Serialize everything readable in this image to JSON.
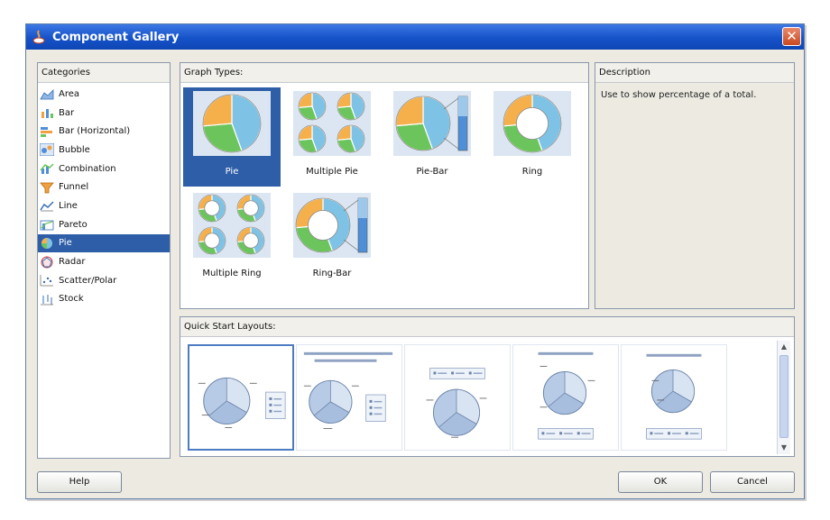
{
  "window": {
    "title": "Component Gallery",
    "close_glyph": "✕"
  },
  "categories": {
    "header": "Categories",
    "items": [
      {
        "label": "Area",
        "icon": "area-chart-icon"
      },
      {
        "label": "Bar",
        "icon": "bar-chart-icon"
      },
      {
        "label": "Bar (Horizontal)",
        "icon": "horizontal-bar-chart-icon"
      },
      {
        "label": "Bubble",
        "icon": "bubble-chart-icon"
      },
      {
        "label": "Combination",
        "icon": "combination-chart-icon"
      },
      {
        "label": "Funnel",
        "icon": "funnel-chart-icon"
      },
      {
        "label": "Line",
        "icon": "line-chart-icon"
      },
      {
        "label": "Pareto",
        "icon": "pareto-chart-icon"
      },
      {
        "label": "Pie",
        "icon": "pie-chart-icon",
        "selected": true
      },
      {
        "label": "Radar",
        "icon": "radar-chart-icon"
      },
      {
        "label": "Scatter/Polar",
        "icon": "scatter-chart-icon"
      },
      {
        "label": "Stock",
        "icon": "stock-chart-icon"
      }
    ]
  },
  "graph_types": {
    "header": "Graph Types:",
    "items": [
      {
        "label": "Pie",
        "selected": true
      },
      {
        "label": "Multiple Pie"
      },
      {
        "label": "Pie-Bar"
      },
      {
        "label": "Ring"
      },
      {
        "label": "Multiple Ring"
      },
      {
        "label": "Ring-Bar"
      }
    ]
  },
  "description": {
    "header": "Description",
    "text": "Use to show percentage of a total."
  },
  "quick_start": {
    "header": "Quick Start Layouts:",
    "layouts": [
      {
        "name": "layout-legend-right",
        "selected": true
      },
      {
        "name": "layout-title-legend-right"
      },
      {
        "name": "layout-legend-top"
      },
      {
        "name": "layout-title-legend-bottom"
      },
      {
        "name": "layout-title-legend-bottom-compact"
      }
    ]
  },
  "buttons": {
    "help": "Help",
    "ok": "OK",
    "cancel": "Cancel"
  },
  "colors": {
    "titlebar": "#1552c9",
    "selection": "#2f5ea8",
    "pie_blue": "#7ec3e6",
    "pie_orange": "#f5b04c",
    "pie_green": "#6cc55c"
  }
}
